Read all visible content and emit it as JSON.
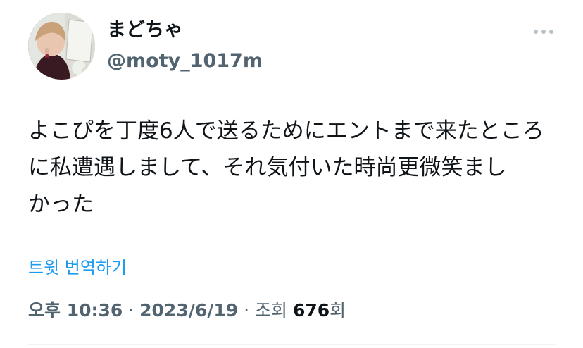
{
  "author": {
    "display_name": "まどちゃ",
    "handle": "@moty_1017m"
  },
  "tweet": {
    "lines": [
      "よこぴを丁度6人で送るためにエントまで来たところ",
      "に私遭遇しまして、それ気付いた時尚更微笑まし",
      "かった"
    ]
  },
  "translate_link": "트윗 번역하기",
  "meta": {
    "time": "오후 10:36",
    "separator1": " · ",
    "date": "2023/6/19",
    "separator2": " · ",
    "views_label": "조회 ",
    "views_count": "676",
    "views_suffix": "회"
  },
  "colors": {
    "text": "#0f1419",
    "secondary": "#536471",
    "link": "#1d9bf0"
  },
  "icons": {
    "more": "more-horizontal-icon"
  }
}
